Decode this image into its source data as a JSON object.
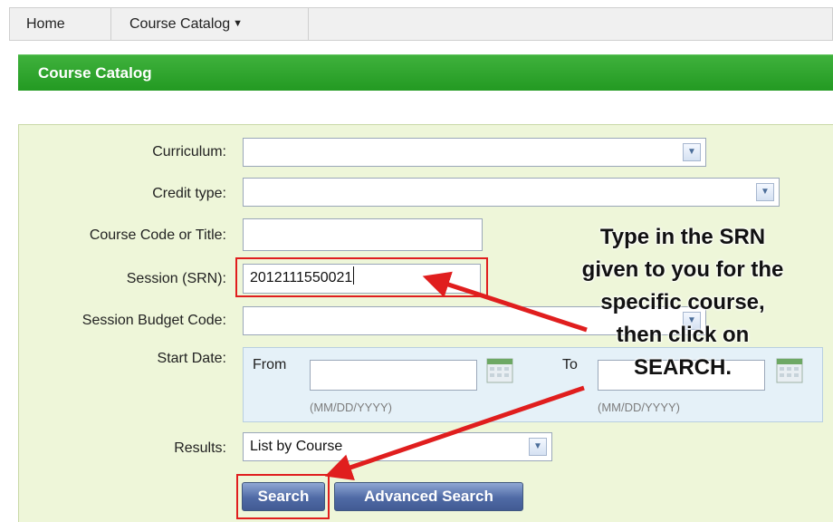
{
  "nav": {
    "home": "Home",
    "catalog": "Course Catalog",
    "catalog_caret": "▼"
  },
  "header": {
    "title": "Course Catalog"
  },
  "form": {
    "curriculum_label": "Curriculum:",
    "curriculum_value": "",
    "credit_type_label": "Credit type:",
    "credit_type_value": "",
    "course_code_label": "Course Code or Title:",
    "course_code_value": "",
    "session_label": "Session (SRN):",
    "session_value": "2012111550021",
    "budget_label": "Session Budget Code:",
    "budget_value": "",
    "start_date_label": "Start Date:",
    "from_label": "From",
    "to_label": "To",
    "date_hint": "(MM/DD/YYYY)",
    "results_label": "Results:",
    "results_value": "List by Course",
    "search_button": "Search",
    "advanced_button": "Advanced Search"
  },
  "annotation": {
    "text_lines": [
      "Type in the SRN",
      "given to you for the",
      "specific course,",
      "then click on",
      "SEARCH."
    ],
    "color": "#e01e1e"
  },
  "icons": {
    "dropdown": "chevron-down-icon",
    "calendar": "calendar-icon"
  }
}
